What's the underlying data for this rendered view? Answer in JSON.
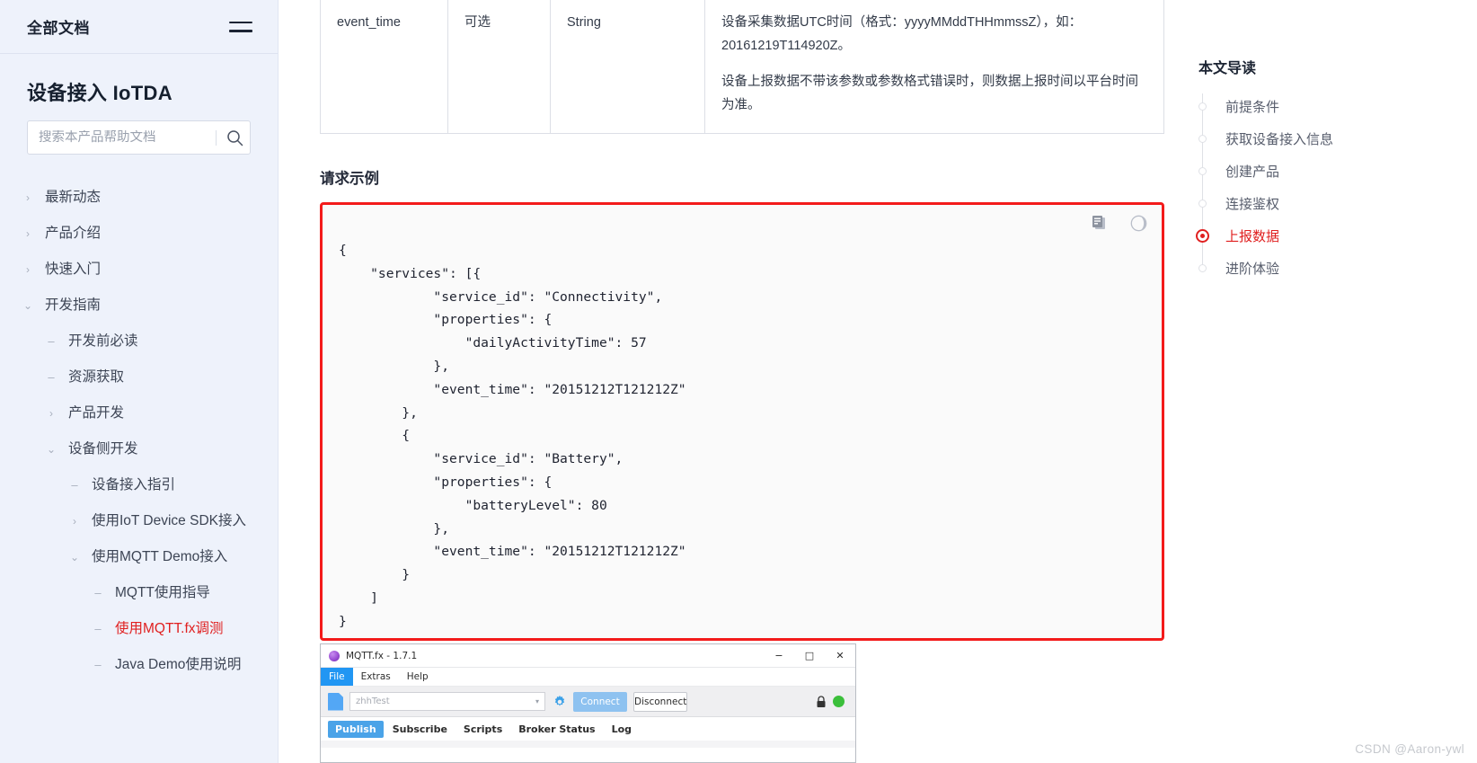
{
  "sidebar": {
    "top_title": "全部文档",
    "menu_icon": "hamburger-icon",
    "product_name": "设备接入 IoTDA",
    "search": {
      "placeholder": "搜索本产品帮助文档",
      "value": "",
      "icon": "search-icon"
    },
    "nav": [
      {
        "label": "最新动态",
        "level": 0,
        "marker": "chevron-right-icon",
        "active": false
      },
      {
        "label": "产品介绍",
        "level": 0,
        "marker": "chevron-right-icon",
        "active": false
      },
      {
        "label": "快速入门",
        "level": 0,
        "marker": "chevron-right-icon",
        "active": false
      },
      {
        "label": "开发指南",
        "level": 0,
        "marker": "chevron-down-icon",
        "active": false
      },
      {
        "label": "开发前必读",
        "level": 1,
        "marker": "dash-icon",
        "active": false
      },
      {
        "label": "资源获取",
        "level": 1,
        "marker": "dash-icon",
        "active": false
      },
      {
        "label": "产品开发",
        "level": 1,
        "marker": "chevron-right-icon",
        "active": false
      },
      {
        "label": "设备侧开发",
        "level": 1,
        "marker": "chevron-down-icon",
        "active": false
      },
      {
        "label": "设备接入指引",
        "level": 2,
        "marker": "dash-icon",
        "active": false
      },
      {
        "label": "使用IoT Device SDK接入",
        "level": 2,
        "marker": "chevron-right-icon",
        "active": false
      },
      {
        "label": "使用MQTT Demo接入",
        "level": 2,
        "marker": "chevron-down-icon",
        "active": false
      },
      {
        "label": "MQTT使用指导",
        "level": 3,
        "marker": "dash-icon",
        "active": false
      },
      {
        "label": "使用MQTT.fx调测",
        "level": 3,
        "marker": "dash-icon",
        "active": true
      },
      {
        "label": "Java Demo使用说明",
        "level": 3,
        "marker": "dash-icon",
        "active": false
      }
    ]
  },
  "main": {
    "table": {
      "row": {
        "name": "event_time",
        "required": "可选",
        "type": "String",
        "desc_1": "设备采集数据UTC时间（格式：yyyyMMddTHHmmssZ），如：20161219T114920Z。",
        "desc_2": "设备上报数据不带该参数或参数格式错误时，则数据上报时间以平台时间为准。"
      }
    },
    "request_example_title": "请求示例",
    "code_toolbar": {
      "copy_icon": "copy-icon",
      "theme_icon": "moon-icon"
    },
    "code": "{\n    \"services\": [{\n            \"service_id\": \"Connectivity\",\n            \"properties\": {\n                \"dailyActivityTime\": 57\n            },\n            \"event_time\": \"20151212T121212Z\"\n        },\n        {\n            \"service_id\": \"Battery\",\n            \"properties\": {\n                \"batteryLevel\": 80\n            },\n            \"event_time\": \"20151212T121212Z\"\n        }\n    ]\n}"
  },
  "mqtt_window": {
    "title": "MQTT.fx - 1.7.1",
    "app_icon": "mqttfx-logo-icon",
    "window_controls": {
      "minimize": "−",
      "maximize": "□",
      "close": "✕"
    },
    "menu": [
      "File",
      "Extras",
      "Help"
    ],
    "menu_selected": "File",
    "connection": {
      "file_icon": "file-icon",
      "profile_value": "zhhTest",
      "dropdown_icon": "chevron-down-icon",
      "gear_icon": "gear-icon",
      "connect_label": "Connect",
      "disconnect_label": "Disconnect",
      "lock_icon": "lock-icon",
      "status_icon": "status-dot-icon"
    },
    "tabs": [
      "Publish",
      "Subscribe",
      "Scripts",
      "Broker Status",
      "Log"
    ],
    "tab_selected": "Publish"
  },
  "toc": {
    "title": "本文导读",
    "items": [
      {
        "label": "前提条件",
        "active": false
      },
      {
        "label": "获取设备接入信息",
        "active": false
      },
      {
        "label": "创建产品",
        "active": false
      },
      {
        "label": "连接鉴权",
        "active": false
      },
      {
        "label": "上报数据",
        "active": true
      },
      {
        "label": "进阶体验",
        "active": false
      }
    ]
  },
  "watermark": "CSDN @Aaron-ywl",
  "colors": {
    "accent_red": "#e02020",
    "code_border": "#f31b1b",
    "sidebar_bg": "#eef2fb",
    "mqtt_blue": "#2196f3"
  }
}
